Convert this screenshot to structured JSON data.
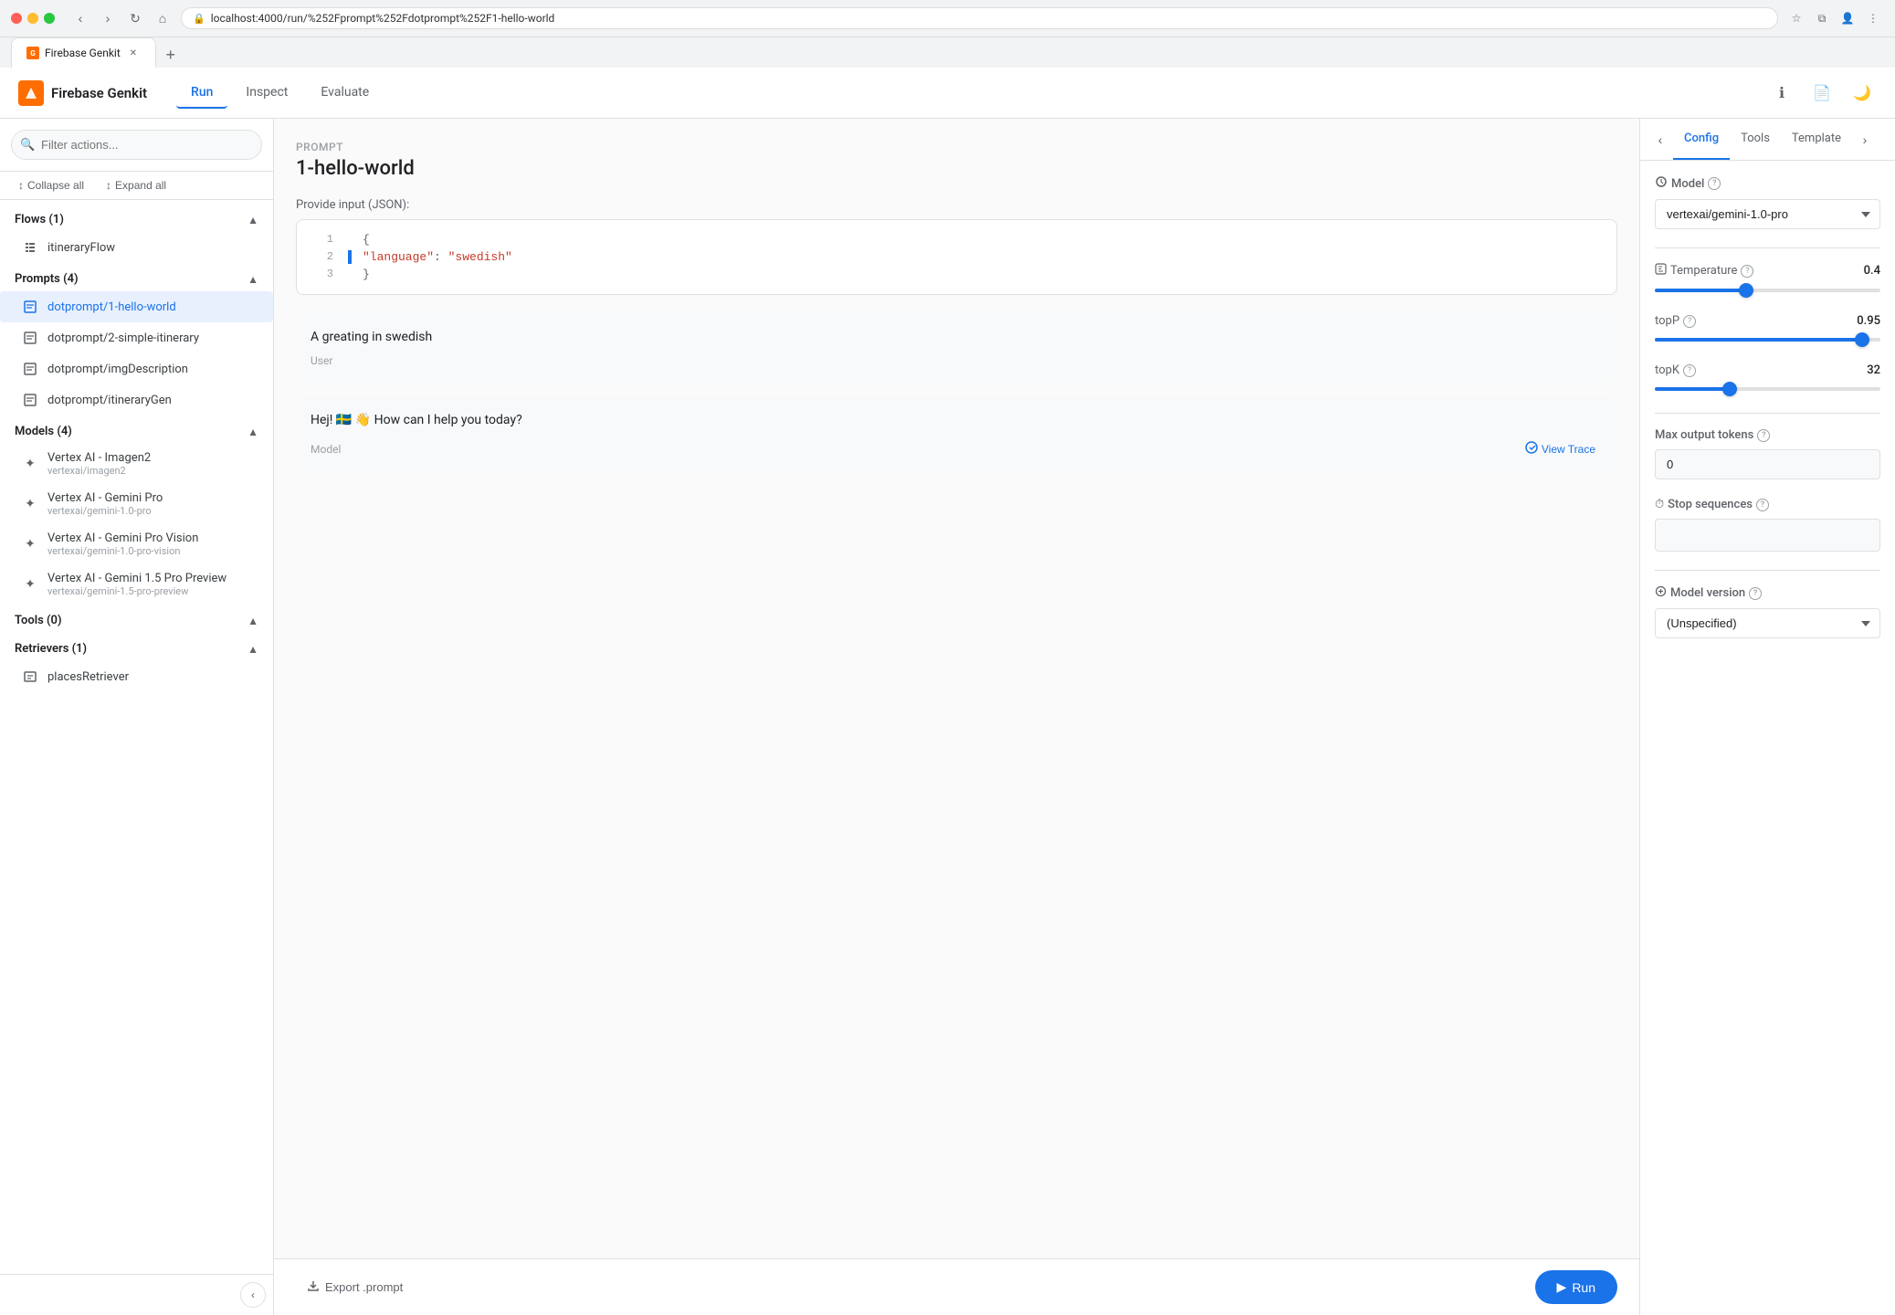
{
  "browser": {
    "url": "localhost:4000/run/%252Fprompt%252Fdotprompt%252F1-hello-world",
    "tab_title": "Firebase Genkit",
    "new_tab_label": "+"
  },
  "app": {
    "logo_text": "Firebase Genkit",
    "nav": {
      "run_label": "Run",
      "inspect_label": "Inspect",
      "evaluate_label": "Evaluate"
    },
    "header_icons": {
      "info": "ℹ",
      "docs": "📄",
      "theme": "🌙"
    }
  },
  "sidebar": {
    "search_placeholder": "Filter actions...",
    "collapse_all_label": "Collapse all",
    "expand_all_label": "Expand all",
    "sections": [
      {
        "id": "flows",
        "title": "Flows (1)",
        "items": [
          {
            "id": "itineraryFlow",
            "label": "itineraryFlow",
            "icon": "flow"
          }
        ]
      },
      {
        "id": "prompts",
        "title": "Prompts (4)",
        "items": [
          {
            "id": "dotprompt-1-hello-world",
            "label": "dotprompt/1-hello-world",
            "icon": "prompt",
            "active": true
          },
          {
            "id": "dotprompt-2-simple-itinerary",
            "label": "dotprompt/2-simple-itinerary",
            "icon": "prompt"
          },
          {
            "id": "dotprompt-imgDescription",
            "label": "dotprompt/imgDescription",
            "icon": "prompt"
          },
          {
            "id": "dotprompt-itineraryGen",
            "label": "dotprompt/itineraryGen",
            "icon": "prompt"
          }
        ]
      },
      {
        "id": "models",
        "title": "Models (4)",
        "items": [
          {
            "id": "vertex-imagen2",
            "label": "Vertex AI - Imagen2",
            "sublabel": "vertexai/imagen2",
            "icon": "model"
          },
          {
            "id": "vertex-gemini-pro",
            "label": "Vertex AI - Gemini Pro",
            "sublabel": "vertexai/gemini-1.0-pro",
            "icon": "model"
          },
          {
            "id": "vertex-gemini-pro-vision",
            "label": "Vertex AI - Gemini Pro Vision",
            "sublabel": "vertexai/gemini-1.0-pro-vision",
            "icon": "model"
          },
          {
            "id": "vertex-gemini-15-preview",
            "label": "Vertex AI - Gemini 1.5 Pro Preview",
            "sublabel": "vertexai/gemini-1.5-pro-preview",
            "icon": "model"
          }
        ]
      },
      {
        "id": "tools",
        "title": "Tools (0)",
        "items": []
      },
      {
        "id": "retrievers",
        "title": "Retrievers (1)",
        "items": [
          {
            "id": "placesRetriever",
            "label": "placesRetriever",
            "icon": "retriever"
          }
        ]
      }
    ]
  },
  "main": {
    "prompt_label": "Prompt",
    "prompt_title": "1-hello-world",
    "input_section_label": "Provide input (JSON):",
    "json_lines": [
      {
        "num": 1,
        "content": "{",
        "type": "punct"
      },
      {
        "num": 2,
        "content": "\"language\": \"swedish\"",
        "type": "keyvalue",
        "key": "\"language\"",
        "value": "\"swedish\""
      },
      {
        "num": 3,
        "content": "}",
        "type": "punct"
      }
    ],
    "messages": [
      {
        "id": "user-msg",
        "text": "A greating in swedish",
        "role": "User",
        "type": "input"
      },
      {
        "id": "model-msg",
        "text": "Hej! 🇸🇪 👋 How can I help you today?",
        "role": "Model",
        "type": "output",
        "view_trace_label": "View Trace"
      }
    ],
    "bottom_bar": {
      "export_label": "Export .prompt",
      "run_label": "Run"
    }
  },
  "right_panel": {
    "tabs": [
      {
        "id": "config",
        "label": "Config",
        "active": true
      },
      {
        "id": "tools",
        "label": "Tools"
      },
      {
        "id": "template",
        "label": "Template"
      }
    ],
    "config": {
      "model_label": "Model",
      "model_value": "vertexai/gemini-1.0-pro",
      "model_options": [
        "vertexai/gemini-1.0-pro",
        "vertexai/gemini-1.5-pro-preview",
        "vertexai/gemini-1.0-pro-vision",
        "vertexai/imagen2"
      ],
      "temperature_label": "Temperature",
      "temperature_value": "0.4",
      "temperature_slider_pct": "40%",
      "topp_label": "topP",
      "topp_value": "0.95",
      "topp_slider_pct": "95%",
      "topk_label": "topK",
      "topk_value": "32",
      "topk_slider_pct": "32%",
      "max_tokens_label": "Max output tokens",
      "max_tokens_value": "0",
      "stop_sequences_label": "Stop sequences",
      "stop_sequences_value": "",
      "model_version_label": "Model version",
      "model_version_value": "(Unspecified)",
      "model_version_options": [
        "(Unspecified)"
      ]
    }
  }
}
